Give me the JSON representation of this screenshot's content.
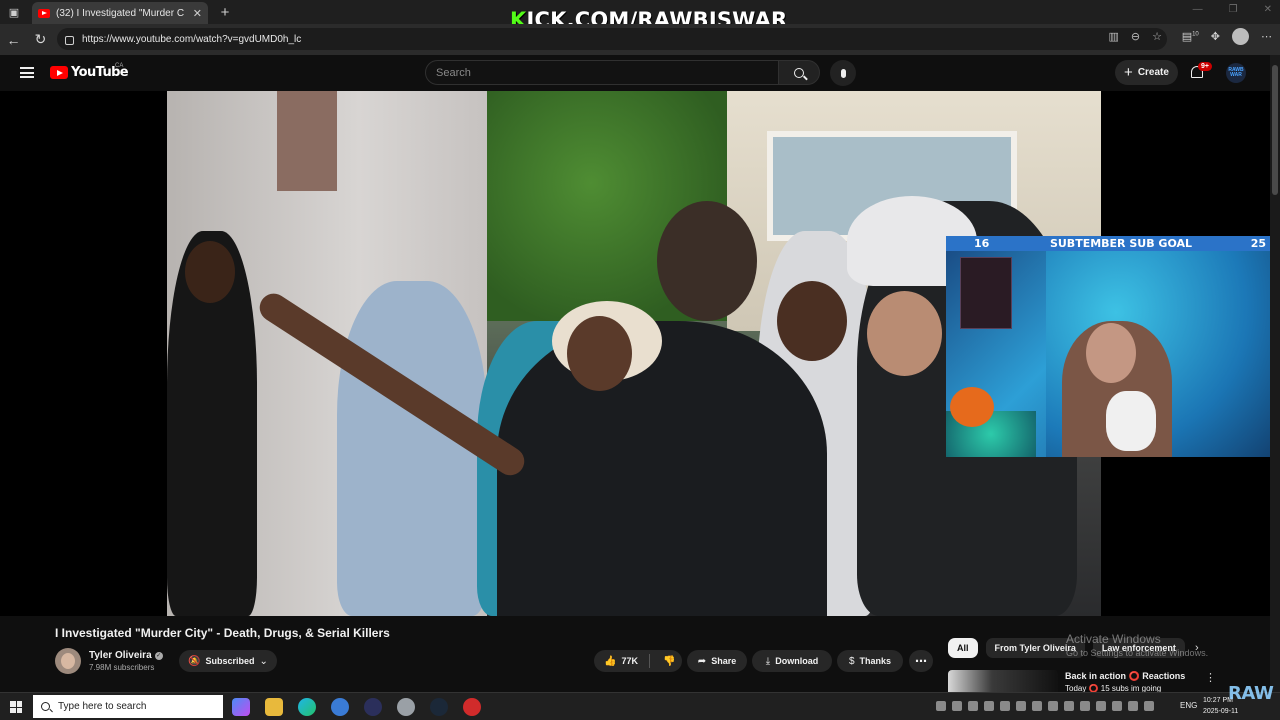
{
  "browser": {
    "tab_title": "(32) I Investigated \"Murder C",
    "url": "https://www.youtube.com/watch?v=gvdUMD0h_lc",
    "extension_badge": "10"
  },
  "stream_overlay": {
    "kick_url_prefix": "K",
    "kick_url_rest": "ICK.COM/RAWBISWAR",
    "goal_current": "16",
    "goal_title": "SUBTEMBER SUB GOAL",
    "goal_target": "25"
  },
  "youtube": {
    "logo_text": "YouTube",
    "region": "CA",
    "search_placeholder": "Search",
    "create_label": "Create",
    "notification_count": "9+",
    "account_avatar_text": "RAWB WAR"
  },
  "video": {
    "title": "I Investigated \"Murder City\" - Death, Drugs, & Serial Killers",
    "channel_name": "Tyler Oliveira",
    "subscribers": "7.98M subscribers",
    "subscribe_state": "Subscribed",
    "likes": "77K",
    "share_label": "Share",
    "download_label": "Download",
    "thanks_label": "Thanks"
  },
  "recommendations": {
    "chips": [
      "All",
      "From Tyler Oliveira",
      "Law enforcement"
    ],
    "active_chip": "All",
    "first_item_title": "Back in action ⭕ Reactions",
    "first_item_sub": "Today ⭕ 15 subs im going"
  },
  "watermark": {
    "line1": "Activate Windows",
    "line2": "Go to Settings to activate Windows."
  },
  "taskbar": {
    "search_placeholder": "Type here to search",
    "language": "ENG",
    "time": "10:27 PM",
    "date": "2025-09-11"
  },
  "corner_badge": "RAW",
  "colors": {
    "youtube_red": "#ff0000",
    "kick_green": "#53fc18",
    "goal_bar": "#2b73c8",
    "background": "#0f0f0f"
  }
}
